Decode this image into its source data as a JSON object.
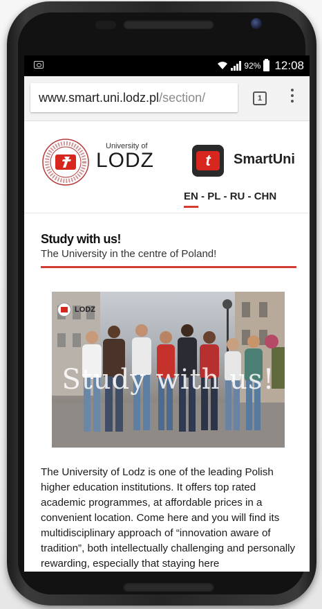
{
  "status": {
    "battery_pct": "92%",
    "time": "12:08"
  },
  "browser": {
    "url_host": "www.smart.uni.lodz.pl",
    "url_path": "/section/",
    "tab_count": "1"
  },
  "header": {
    "university_of": "University of",
    "lodz": "LODZ",
    "app_icon_letter": "t",
    "app_name": "SmartUni",
    "languages": [
      "EN",
      "PL",
      "RU",
      "CHN"
    ],
    "lang_sep": " - "
  },
  "main": {
    "title": "Study with us!",
    "subtitle": "The University in the centre of Poland!",
    "photo_logo_text": "LODZ",
    "photo_overlay": "Study with us!",
    "body": "The University of Lodz is one of the leading Polish higher education institutions. It offers top rated academic programmes, at affordable prices in a convenient location. Come here and you will find its multidisciplinary approach of “innovation aware of tradition”, both intellectually challenging and personally rewarding, especially that staying here"
  },
  "colors": {
    "accent": "#d23c33",
    "logo_red": "#d7261e"
  }
}
